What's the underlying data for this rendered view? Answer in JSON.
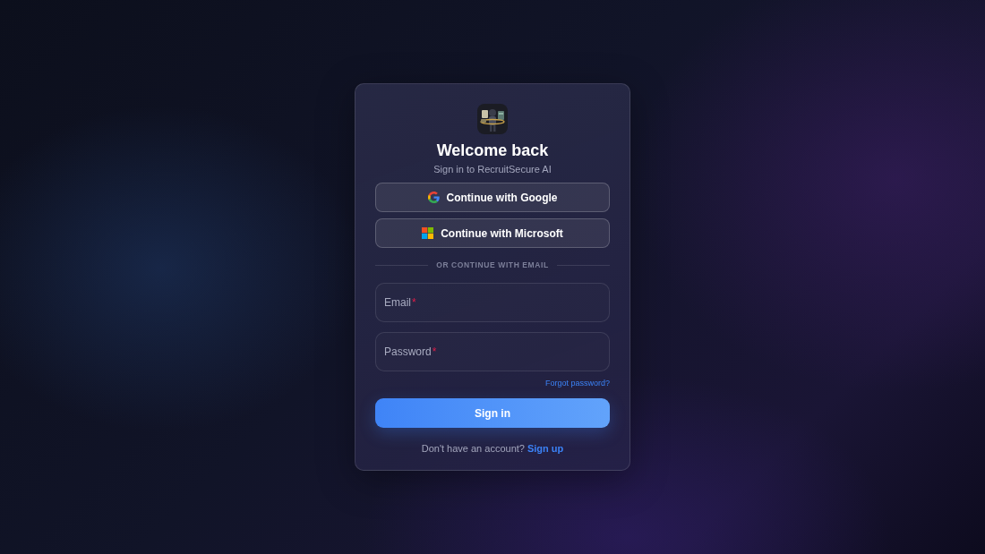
{
  "title": "Welcome back",
  "subtitle": "Sign in to RecruitSecure AI",
  "social_buttons": [
    {
      "kind": "google",
      "label": "Continue with Google"
    },
    {
      "kind": "microsoft",
      "label": "Continue with Microsoft"
    }
  ],
  "divider": "OR CONTINUE WITH EMAIL",
  "fields": [
    {
      "label": "Email",
      "required_mark": "*"
    },
    {
      "label": "Password",
      "required_mark": "*"
    }
  ],
  "forgot_link": "Forgot password?",
  "submit_button": "Sign in",
  "footer": {
    "text": "Don't have an account?",
    "link": "Sign up"
  }
}
